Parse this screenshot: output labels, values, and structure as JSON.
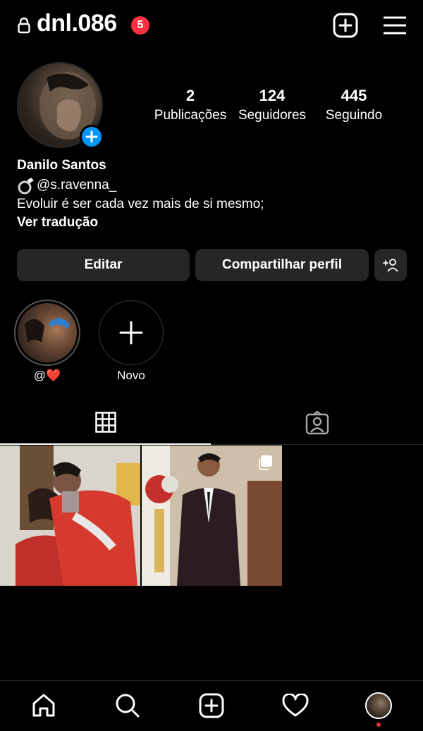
{
  "header": {
    "username": "dnl.086",
    "notification_count": "5"
  },
  "profile": {
    "stats": [
      {
        "value": "2",
        "label": "Publicações"
      },
      {
        "value": "124",
        "label": "Seguidores"
      },
      {
        "value": "445",
        "label": "Seguindo"
      }
    ],
    "name": "Danilo Santos",
    "handle": "@s.ravenna_",
    "bio": "Evoluir é ser cada vez mais de si mesmo;",
    "translate": "Ver tradução"
  },
  "actions": {
    "edit": "Editar",
    "share": "Compartilhar perfil"
  },
  "highlights": [
    {
      "label": "@❤️"
    },
    {
      "label": "Novo"
    }
  ],
  "colors": {
    "accent": "#0095f6",
    "badge": "#ff3040",
    "button_bg": "#262626",
    "background": "#000000"
  },
  "icons": {
    "lock": "lock-icon",
    "new_post": "plus-square-icon",
    "menu": "hamburger-icon",
    "grid": "grid-icon",
    "tagged": "tagged-icon",
    "home": "home-icon",
    "search": "search-icon",
    "create": "create-icon",
    "activity": "heart-icon",
    "profile": "profile-avatar"
  }
}
